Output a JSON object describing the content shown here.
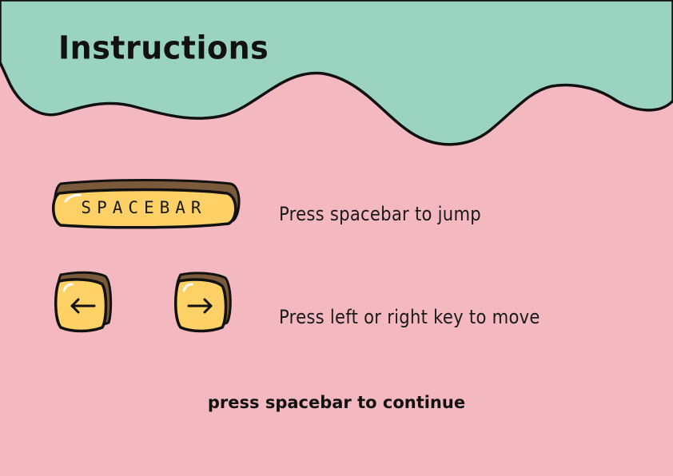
{
  "screen": {
    "title": "Instructions",
    "colors": {
      "background": "#f4b8c0",
      "banner": "#9ad4c0",
      "key_fill": "#fdd166",
      "key_shadow": "#7a5a3a",
      "outline": "#111111"
    }
  },
  "controls": [
    {
      "key_label": "SPACEBAR",
      "description": "Press spacebar to jump"
    },
    {
      "left_icon": "arrow-left-icon",
      "right_icon": "arrow-right-icon",
      "description": "Press left or right key to move"
    }
  ],
  "footer": {
    "prompt": "press spacebar to continue"
  }
}
